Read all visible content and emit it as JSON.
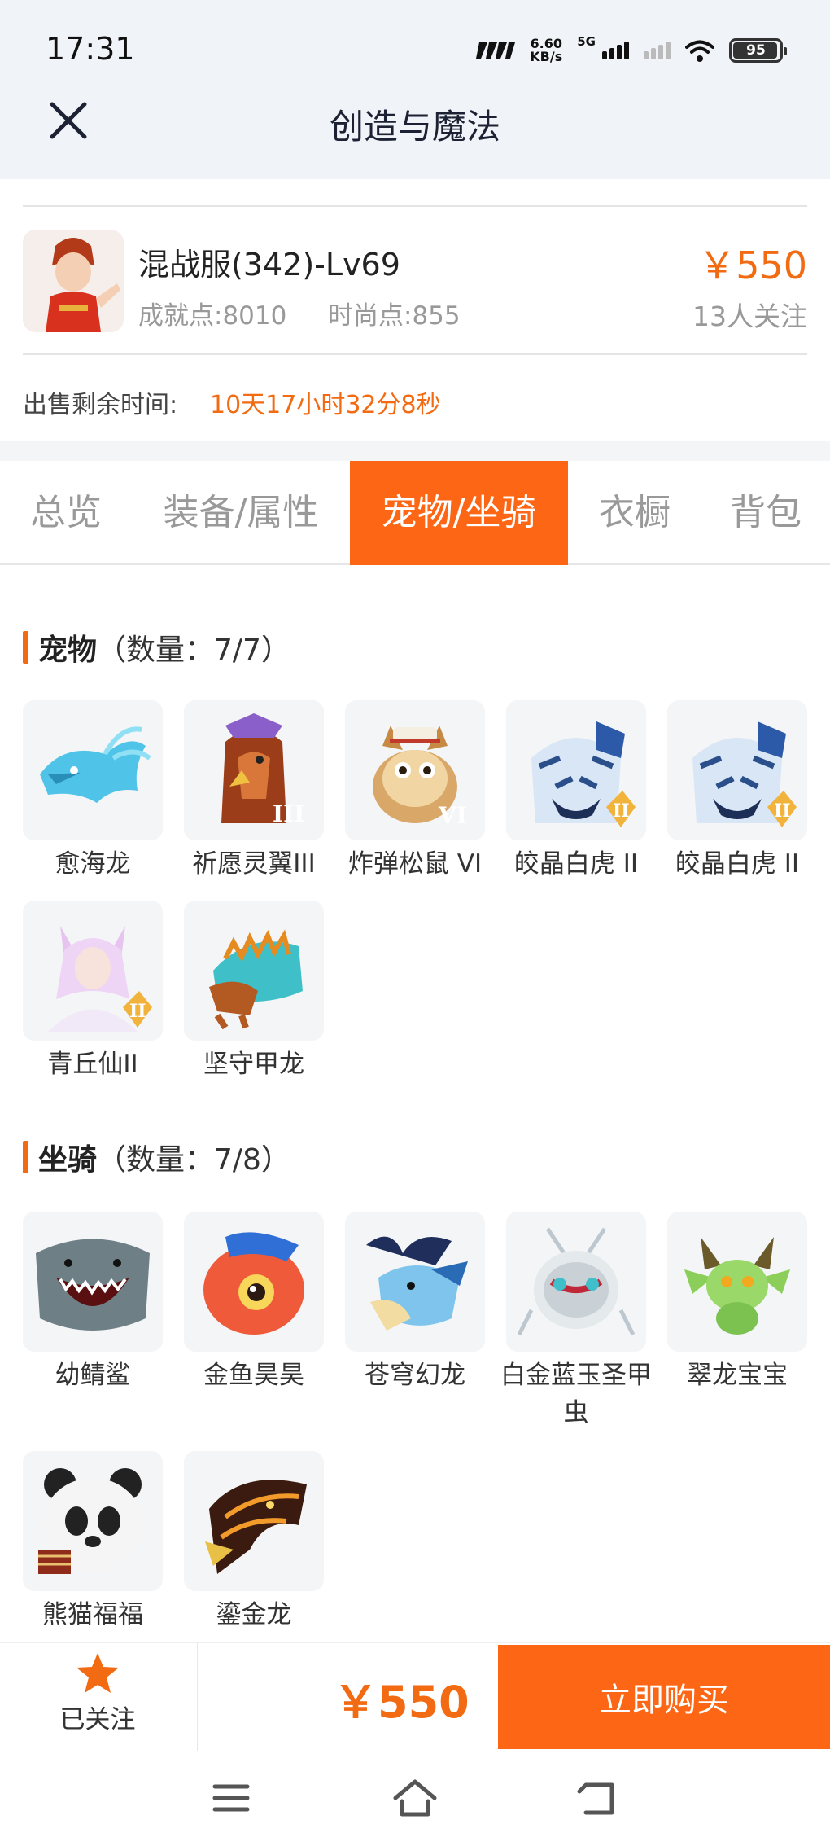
{
  "status_bar": {
    "time": "17:31",
    "net_speed_value": "6.60",
    "net_speed_unit": "KB/s",
    "network": "5G",
    "battery": "95"
  },
  "header": {
    "title": "创造与魔法"
  },
  "listing": {
    "name": "混战服(342)-Lv69",
    "achievement": "成就点:8010",
    "fashion": "时尚点:855",
    "price": "￥550",
    "followers": "13人关注",
    "remaining_label": "出售剩余时间:",
    "remaining_value": "10天17小时32分8秒"
  },
  "tabs": [
    {
      "label": "总览",
      "active": false
    },
    {
      "label": "装备/属性",
      "active": false
    },
    {
      "label": "宠物/坐骑",
      "active": true
    },
    {
      "label": "衣橱",
      "active": false
    },
    {
      "label": "背包",
      "active": false
    }
  ],
  "pets": {
    "title": "宠物",
    "count": "（数量：7/7）",
    "items": [
      {
        "name": "愈海龙",
        "badge": "",
        "icon": "ice-dragon-icon"
      },
      {
        "name": "祈愿灵翼III",
        "badge": "III",
        "icon": "eagle-icon"
      },
      {
        "name": "炸弹松鼠 VI",
        "badge": "VI",
        "icon": "squirrel-icon"
      },
      {
        "name": "皎晶白虎 II",
        "badge": "II",
        "icon": "white-tiger-icon"
      },
      {
        "name": "皎晶白虎 II",
        "badge": "II",
        "icon": "white-tiger-icon"
      },
      {
        "name": "青丘仙II",
        "badge": "II",
        "icon": "fox-fairy-icon"
      },
      {
        "name": "坚守甲龙",
        "badge": "",
        "icon": "armored-dragon-icon"
      }
    ]
  },
  "mounts": {
    "title": "坐骑",
    "count": "（数量：7/8）",
    "items": [
      {
        "name": "幼鲭鲨",
        "icon": "shark-icon"
      },
      {
        "name": "金鱼昊昊",
        "icon": "goldfish-icon"
      },
      {
        "name": "苍穹幻龙",
        "icon": "sky-dragon-icon"
      },
      {
        "name": "白金蓝玉圣甲虫",
        "icon": "scarab-icon"
      },
      {
        "name": "翠龙宝宝",
        "icon": "baby-dragon-icon"
      },
      {
        "name": "熊猫福福",
        "icon": "panda-icon"
      },
      {
        "name": "鎏金龙",
        "icon": "golden-dragon-icon"
      }
    ]
  },
  "bottom_bar": {
    "follow_label": "已关注",
    "price": "￥550",
    "buy_label": "立即购买"
  },
  "colors": {
    "accent": "#fd6614",
    "price": "#f26a12",
    "header_bg": "#f0f3f7"
  }
}
